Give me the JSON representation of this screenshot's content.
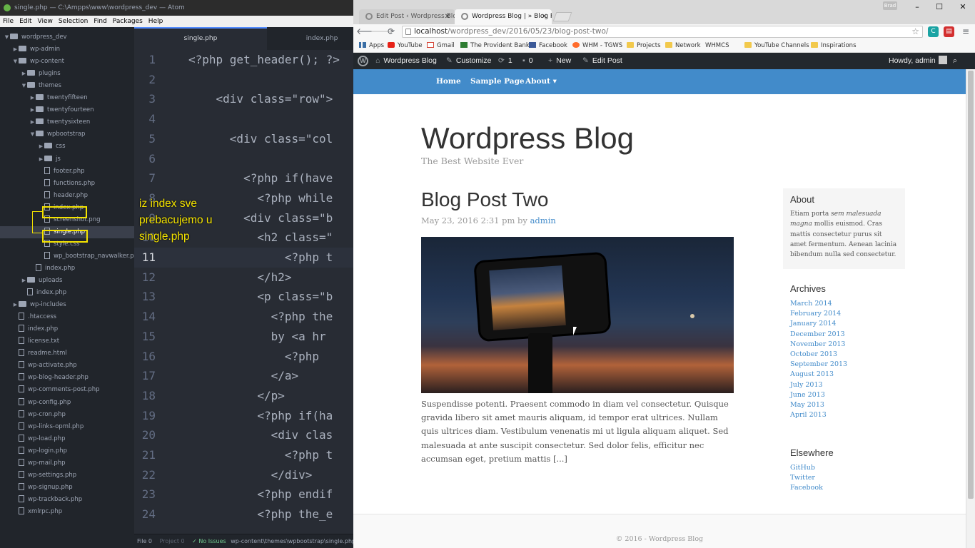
{
  "atom": {
    "title": "single.php — C:\\Ampps\\www\\wordpress_dev — Atom",
    "menu": [
      "File",
      "Edit",
      "View",
      "Selection",
      "Find",
      "Packages",
      "Help"
    ],
    "tree": [
      {
        "label": "wordpress_dev",
        "type": "folder",
        "open": true
      },
      {
        "label": "wp-admin",
        "type": "folder",
        "open": false
      },
      {
        "label": "wp-content",
        "type": "folder",
        "open": true
      },
      {
        "label": "plugins",
        "type": "folder",
        "open": false
      },
      {
        "label": "themes",
        "type": "folder",
        "open": true
      },
      {
        "label": "twentyfifteen",
        "type": "folder",
        "open": false
      },
      {
        "label": "twentyfourteen",
        "type": "folder",
        "open": false
      },
      {
        "label": "twentysixteen",
        "type": "folder",
        "open": false
      },
      {
        "label": "wpbootstrap",
        "type": "folder",
        "open": true
      },
      {
        "label": "css",
        "type": "folder",
        "open": false
      },
      {
        "label": "js",
        "type": "folder",
        "open": false
      },
      {
        "label": "footer.php",
        "type": "file"
      },
      {
        "label": "functions.php",
        "type": "file"
      },
      {
        "label": "header.php",
        "type": "file"
      },
      {
        "label": "index.php",
        "type": "file"
      },
      {
        "label": "screenshot.png",
        "type": "file"
      },
      {
        "label": "single.php",
        "type": "file"
      },
      {
        "label": "style.css",
        "type": "file"
      },
      {
        "label": "wp_bootstrap_navwalker.php",
        "type": "file"
      },
      {
        "label": "index.php",
        "type": "file"
      },
      {
        "label": "uploads",
        "type": "folder",
        "open": false
      },
      {
        "label": "index.php",
        "type": "file"
      },
      {
        "label": "wp-includes",
        "type": "folder",
        "open": false
      },
      {
        "label": ".htaccess",
        "type": "file"
      },
      {
        "label": "index.php",
        "type": "file"
      },
      {
        "label": "license.txt",
        "type": "file"
      },
      {
        "label": "readme.html",
        "type": "file"
      },
      {
        "label": "wp-activate.php",
        "type": "file"
      },
      {
        "label": "wp-blog-header.php",
        "type": "file"
      },
      {
        "label": "wp-comments-post.php",
        "type": "file"
      },
      {
        "label": "wp-config.php",
        "type": "file"
      },
      {
        "label": "wp-cron.php",
        "type": "file"
      },
      {
        "label": "wp-links-opml.php",
        "type": "file"
      },
      {
        "label": "wp-load.php",
        "type": "file"
      },
      {
        "label": "wp-login.php",
        "type": "file"
      },
      {
        "label": "wp-mail.php",
        "type": "file"
      },
      {
        "label": "wp-settings.php",
        "type": "file"
      },
      {
        "label": "wp-signup.php",
        "type": "file"
      },
      {
        "label": "wp-trackback.php",
        "type": "file"
      },
      {
        "label": "xmlrpc.php",
        "type": "file"
      }
    ],
    "tabs": [
      "single.php",
      "index.php"
    ],
    "code_lines": [
      {
        "n": "1",
        "text": "<?php get_header(); ?>"
      },
      {
        "n": "2",
        "text": ""
      },
      {
        "n": "3",
        "text": "    <div class=\"row\">"
      },
      {
        "n": "4",
        "text": ""
      },
      {
        "n": "5",
        "text": "      <div class=\"col"
      },
      {
        "n": "6",
        "text": ""
      },
      {
        "n": "7",
        "text": "        <?php if(have"
      },
      {
        "n": "8",
        "text": "          <?php while"
      },
      {
        "n": "9",
        "text": "        <div class=\"b"
      },
      {
        "n": "10",
        "text": "          <h2 class=\""
      },
      {
        "n": "11",
        "text": "              <?php t"
      },
      {
        "n": "12",
        "text": "          </h2>"
      },
      {
        "n": "13",
        "text": "          <p class=\"b"
      },
      {
        "n": "14",
        "text": "            <?php the"
      },
      {
        "n": "15",
        "text": "            by <a hr"
      },
      {
        "n": "16",
        "text": "              <?php "
      },
      {
        "n": "17",
        "text": "            </a>"
      },
      {
        "n": "18",
        "text": "          </p>"
      },
      {
        "n": "19",
        "text": "          <?php if(ha"
      },
      {
        "n": "20",
        "text": "            <div clas"
      },
      {
        "n": "21",
        "text": "              <?php t"
      },
      {
        "n": "22",
        "text": "            </div>"
      },
      {
        "n": "23",
        "text": "          <?php endif"
      },
      {
        "n": "24",
        "text": "          <?php the_e"
      }
    ],
    "current_line": "11",
    "annotation": "iz index sve prebacujemo u single.php",
    "status": {
      "file": "File 0",
      "project": "Project 0",
      "issues": "✓ No Issues",
      "path": "wp-content\\themes\\wpbootstrap\\single.php"
    }
  },
  "chrome": {
    "tabs": [
      {
        "title": "Edit Post ‹ Wordpress Blo...",
        "active": false
      },
      {
        "title": "Wordpress Blog | » Blog P",
        "active": true
      }
    ],
    "user_badge": "Brad",
    "url_host": "localhost",
    "url_path": "/wordpress_dev/2016/05/23/blog-post-two/",
    "bookmarks": [
      {
        "label": "Apps",
        "icon": "grid"
      },
      {
        "label": "YouTube",
        "icon": "yt"
      },
      {
        "label": "Gmail",
        "icon": "gm"
      },
      {
        "label": "The Provident Bank",
        "icon": "pb"
      },
      {
        "label": "Facebook",
        "icon": "fb"
      },
      {
        "label": "WHM - TGWS",
        "icon": "whm"
      },
      {
        "label": "Projects",
        "icon": "folder"
      },
      {
        "label": "Network",
        "icon": "folder"
      },
      {
        "label": "WHMCS",
        "icon": "page"
      },
      {
        "label": "YouTube Channels",
        "icon": "folder"
      },
      {
        "label": "Inspirations",
        "icon": "folder"
      }
    ]
  },
  "wp": {
    "adminbar": {
      "site": "Wordpress Blog",
      "customize": "Customize",
      "updates": "1",
      "comments": "0",
      "new": "New",
      "edit": "Edit Post",
      "howdy": "Howdy, admin"
    },
    "nav": [
      "Home",
      "Sample Page",
      "About ▾"
    ],
    "blog_title": "Wordpress Blog",
    "blog_desc": "The Best Website Ever",
    "post": {
      "title": "Blog Post Two",
      "date": "May 23, 2016 2:31 pm by ",
      "author": "admin",
      "excerpt": "Suspendisse potenti. Praesent commodo in diam vel consectetur. Quisque gravida libero sit amet mauris aliquam, id tempor erat ultrices. Nullam quis ultrices diam. Vestibulum venenatis mi ut ligula aliquam aliquet. Sed malesuada at ante suscipit consectetur. Sed dolor felis, efficitur nec accumsan eget, pretium mattis [...]"
    },
    "sidebar": {
      "about_title": "About",
      "about_text_1": "Etiam porta ",
      "about_text_em": "sem malesuada magna",
      "about_text_2": " mollis euismod. Cras mattis consectetur purus sit amet fermentum. Aenean lacinia bibendum nulla sed consectetur.",
      "archives_title": "Archives",
      "archives": [
        "March 2014",
        "February 2014",
        "January 2014",
        "December 2013",
        "November 2013",
        "October 2013",
        "September 2013",
        "August 2013",
        "July 2013",
        "June 2013",
        "May 2013",
        "April 2013"
      ],
      "elsewhere_title": "Elsewhere",
      "elsewhere": [
        "GitHub",
        "Twitter",
        "Facebook"
      ]
    },
    "footer": "© 2016 - Wordpress Blog"
  },
  "colors": {
    "wp_nav": "#428bca",
    "link": "#428bca",
    "highlight": "#f5e400",
    "atom_bg": "#282c34"
  }
}
